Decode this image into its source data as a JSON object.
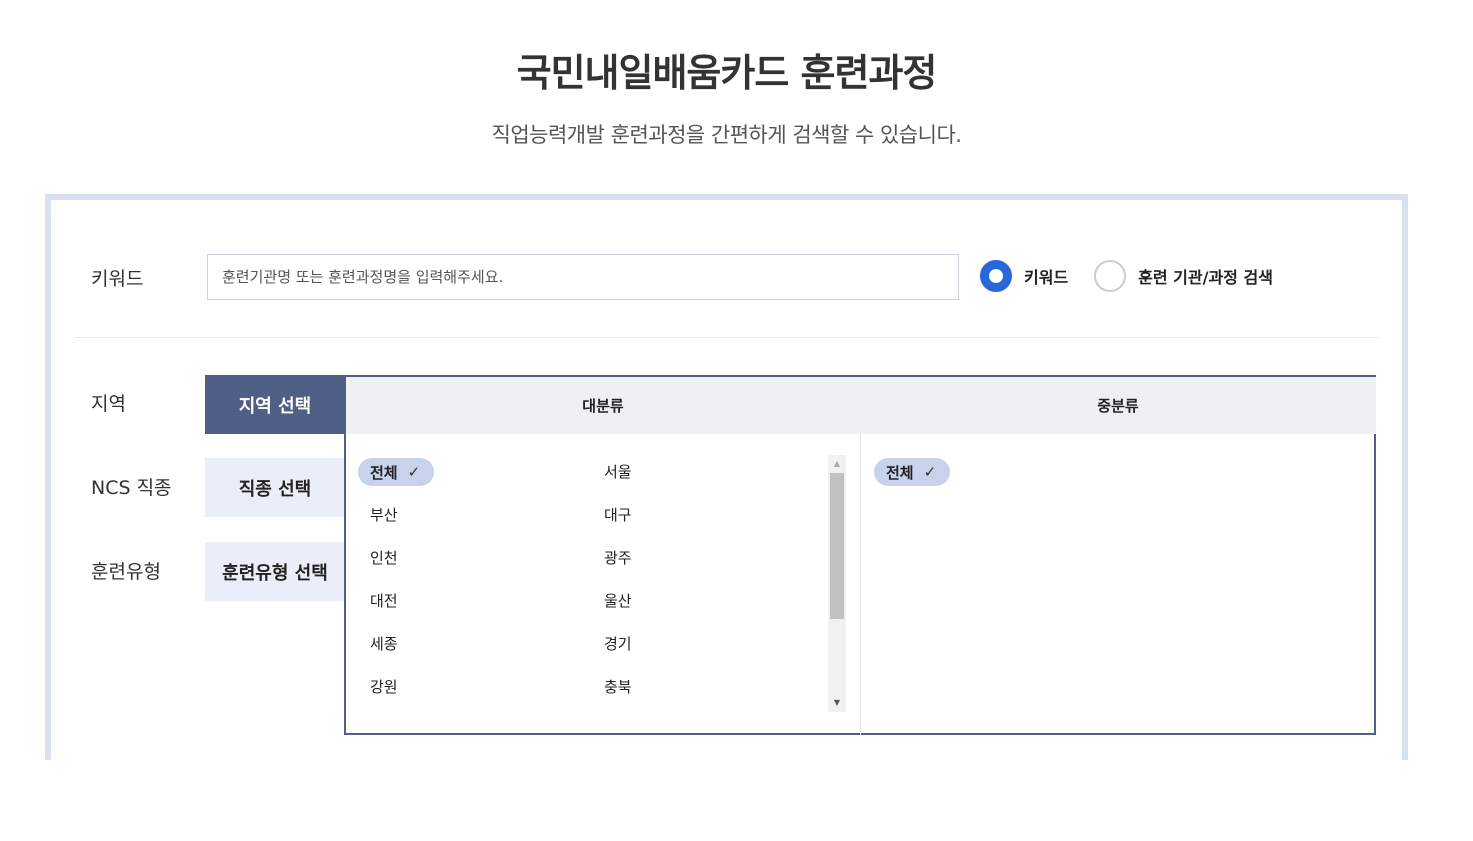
{
  "header": {
    "title": "국민내일배움카드 훈련과정",
    "subtitle": "직업능력개발 훈련과정을 간편하게 검색할 수 있습니다."
  },
  "keyword": {
    "label": "키워드",
    "placeholder": "훈련기관명 또는 훈련과정명을 입력해주세요.",
    "value": "",
    "radios": [
      {
        "label": "키워드",
        "selected": true
      },
      {
        "label": "훈련 기관/과정 검색",
        "selected": false
      }
    ]
  },
  "filters": {
    "labels": {
      "region": "지역",
      "ncs": "NCS 직종",
      "training_type": "훈련유형"
    },
    "tabs": {
      "region": "지역 선택",
      "ncs": "직종 선택",
      "training_type": "훈련유형 선택"
    },
    "active_tab": "region"
  },
  "region": {
    "major_header": "대분류",
    "minor_header": "중분류",
    "major_selected": "전체",
    "major_items": [
      "부산",
      "인천",
      "대전",
      "세종",
      "강원",
      "서울",
      "대구",
      "광주",
      "울산",
      "경기",
      "충북"
    ],
    "minor_selected": "전체",
    "check_glyph": "✓",
    "scroll_up_glyph": "▲",
    "scroll_down_glyph": "▼"
  },
  "colors": {
    "accent": "#4f5f86",
    "radio_on": "#2767d9",
    "chip": "#c7d3ea",
    "panel_border": "#d9e0ee"
  }
}
